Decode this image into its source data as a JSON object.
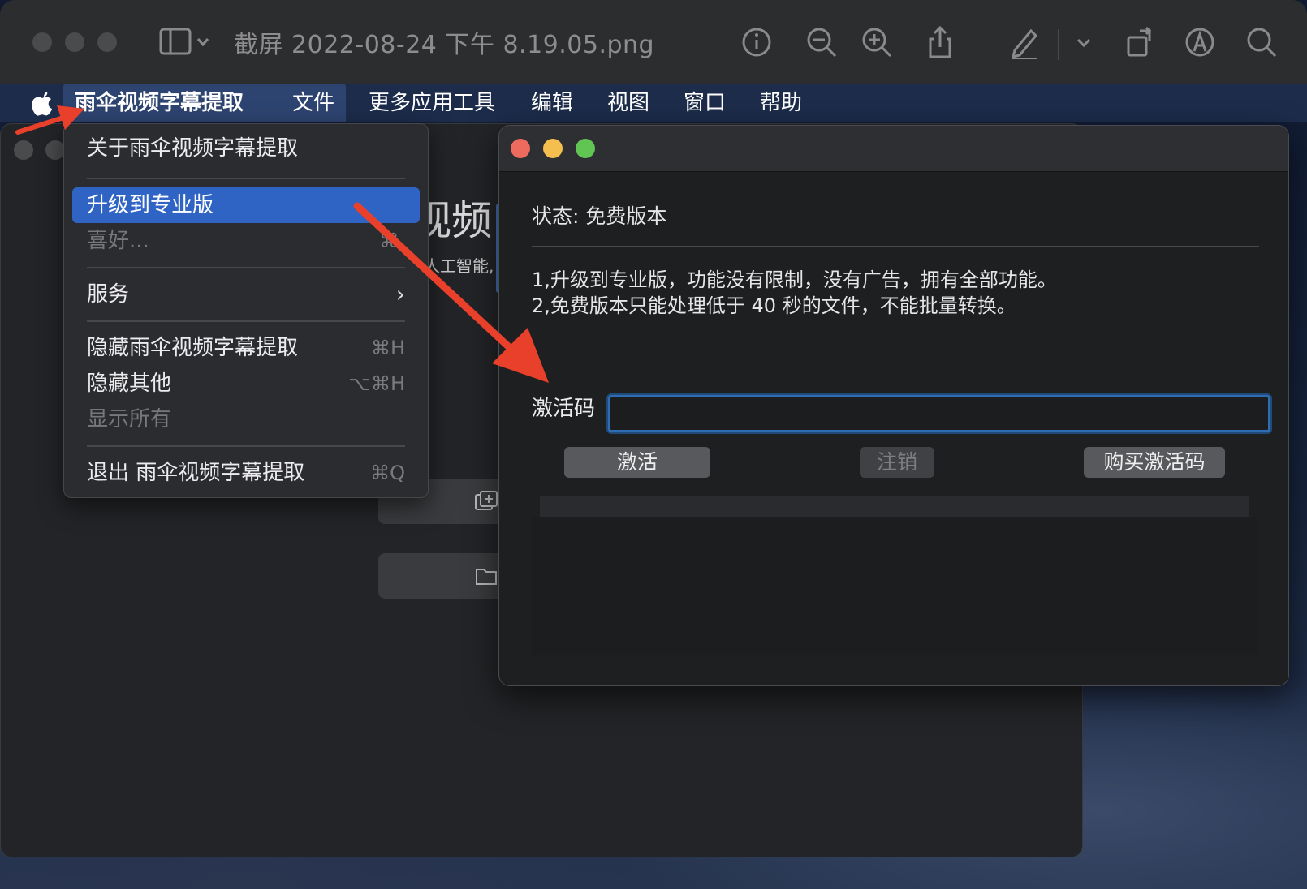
{
  "preview": {
    "title": "截屏 2022-08-24 下午 8.19.05.png"
  },
  "menubar": {
    "items": [
      {
        "label": "雨伞视频字幕提取"
      },
      {
        "label": "文件"
      },
      {
        "label": "更多应用工具"
      },
      {
        "label": "编辑"
      },
      {
        "label": "视图"
      },
      {
        "label": "窗口"
      },
      {
        "label": "帮助"
      }
    ]
  },
  "app_menu": {
    "items": [
      {
        "label": "关于雨伞视频字幕提取",
        "shortcut": ""
      },
      {
        "label": "升级到专业版",
        "shortcut": ""
      },
      {
        "label": "喜好...",
        "shortcut": "⌘,"
      },
      {
        "label": "服务",
        "shortcut": ""
      },
      {
        "label": "隐藏雨伞视频字幕提取",
        "shortcut": "⌘H"
      },
      {
        "label": "隐藏其他",
        "shortcut": "⌥⌘H"
      },
      {
        "label": "显示所有",
        "shortcut": ""
      },
      {
        "label": "退出 雨伞视频字幕提取",
        "shortcut": "⌘Q"
      }
    ]
  },
  "background_app": {
    "title_fragment": "视频",
    "subtitle_fragment": "人工智能,"
  },
  "activation": {
    "status": "状态: 免费版本",
    "desc_line1": "1,升级到专业版，功能没有限制，没有广告，拥有全部功能。",
    "desc_line2": "2,免费版本只能处理低于 40 秒的文件，不能批量转换。",
    "code_label": "激活码",
    "code_value": "",
    "activate_label": "激活",
    "deactivate_label": "注销",
    "buy_label": "购买激活码"
  },
  "colors": {
    "menu_highlight": "#2f64c4",
    "input_focus": "#2f6db3",
    "annotation_arrow": "#e8402a",
    "traffic_close": "#ed6a5e",
    "traffic_min": "#f5bf4f",
    "traffic_max": "#61c554"
  }
}
